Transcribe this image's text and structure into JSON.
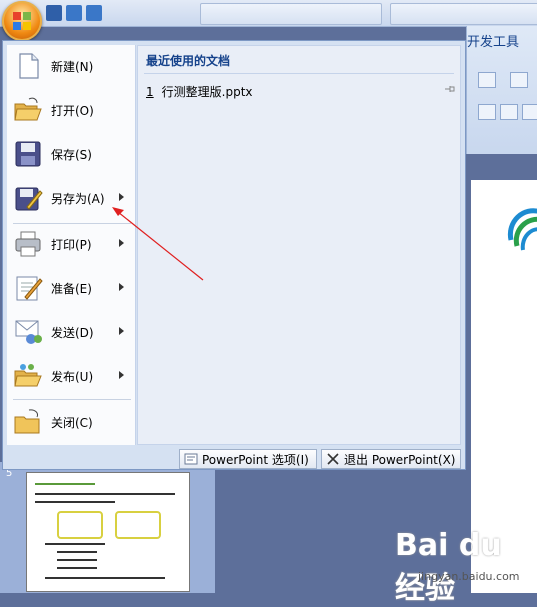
{
  "ribbon": {
    "tab_label": "开发工具"
  },
  "menu": {
    "items": [
      {
        "label": "新建(N)",
        "icon": "new-document-icon",
        "has_submenu": false
      },
      {
        "label": "打开(O)",
        "icon": "open-folder-icon",
        "has_submenu": false
      },
      {
        "label": "保存(S)",
        "icon": "save-disk-icon",
        "has_submenu": false
      },
      {
        "label": "另存为(A)",
        "icon": "save-as-icon",
        "has_submenu": true
      },
      {
        "label": "打印(P)",
        "icon": "printer-icon",
        "has_submenu": true
      },
      {
        "label": "准备(E)",
        "icon": "prepare-icon",
        "has_submenu": true
      },
      {
        "label": "发送(D)",
        "icon": "send-icon",
        "has_submenu": true
      },
      {
        "label": "发布(U)",
        "icon": "publish-icon",
        "has_submenu": true
      },
      {
        "label": "关闭(C)",
        "icon": "close-folder-icon",
        "has_submenu": false
      }
    ],
    "recent": {
      "title": "最近使用的文档",
      "items": [
        {
          "number": "1",
          "name": "行测整理版.pptx"
        }
      ]
    },
    "footer": {
      "options_label": "PowerPoint 选项(I)",
      "exit_label": "退出 PowerPoint(X)"
    }
  },
  "watermark": {
    "brand": "Bai du 经验",
    "url": "jingyan.baidu.com"
  },
  "colors": {
    "menu_bg": "#d5e1f2",
    "accent_orange": "#f08a13",
    "annotation_red": "#e02020",
    "title_blue": "#15428b"
  }
}
